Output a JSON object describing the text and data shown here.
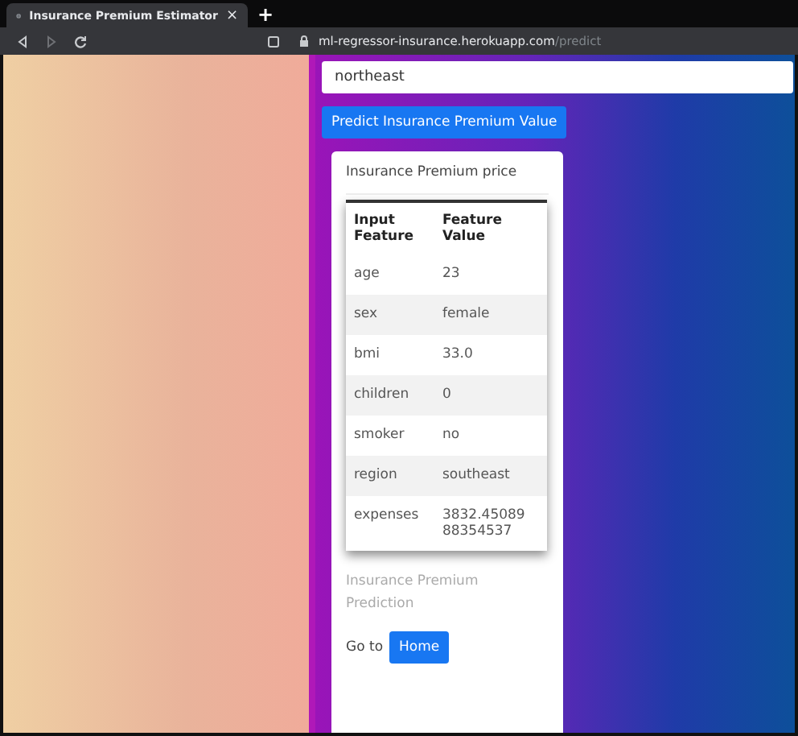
{
  "browser": {
    "tab": {
      "title": "Insurance Premium Estimator",
      "close": "×",
      "new_tab": "+"
    },
    "nav": [
      {
        "kind": "back",
        "disabled": false
      },
      {
        "kind": "forward",
        "disabled": true
      },
      {
        "kind": "reload",
        "disabled": false
      }
    ],
    "url": {
      "host": "ml-regressor-insurance.herokuapp.com",
      "path": "/predict"
    }
  },
  "form": {
    "region_field": {
      "value": "northeast"
    },
    "predict_button": "Predict Insurance Premium Value"
  },
  "card": {
    "title": "Insurance Premium price",
    "table": {
      "columns": [
        "Input Feature",
        "Feature Value"
      ],
      "rows": [
        {
          "feature": "age",
          "value": "23"
        },
        {
          "feature": "sex",
          "value": "female"
        },
        {
          "feature": "bmi",
          "value": "33.0"
        },
        {
          "feature": "children",
          "value": "0"
        },
        {
          "feature": "smoker",
          "value": "no"
        },
        {
          "feature": "region",
          "value": "southeast"
        },
        {
          "feature": "expenses",
          "value": "3832.45089 88354537"
        }
      ]
    },
    "prediction_label": "Insurance Premium Prediction",
    "footer": {
      "text": "Go to",
      "home_button": "Home"
    }
  }
}
